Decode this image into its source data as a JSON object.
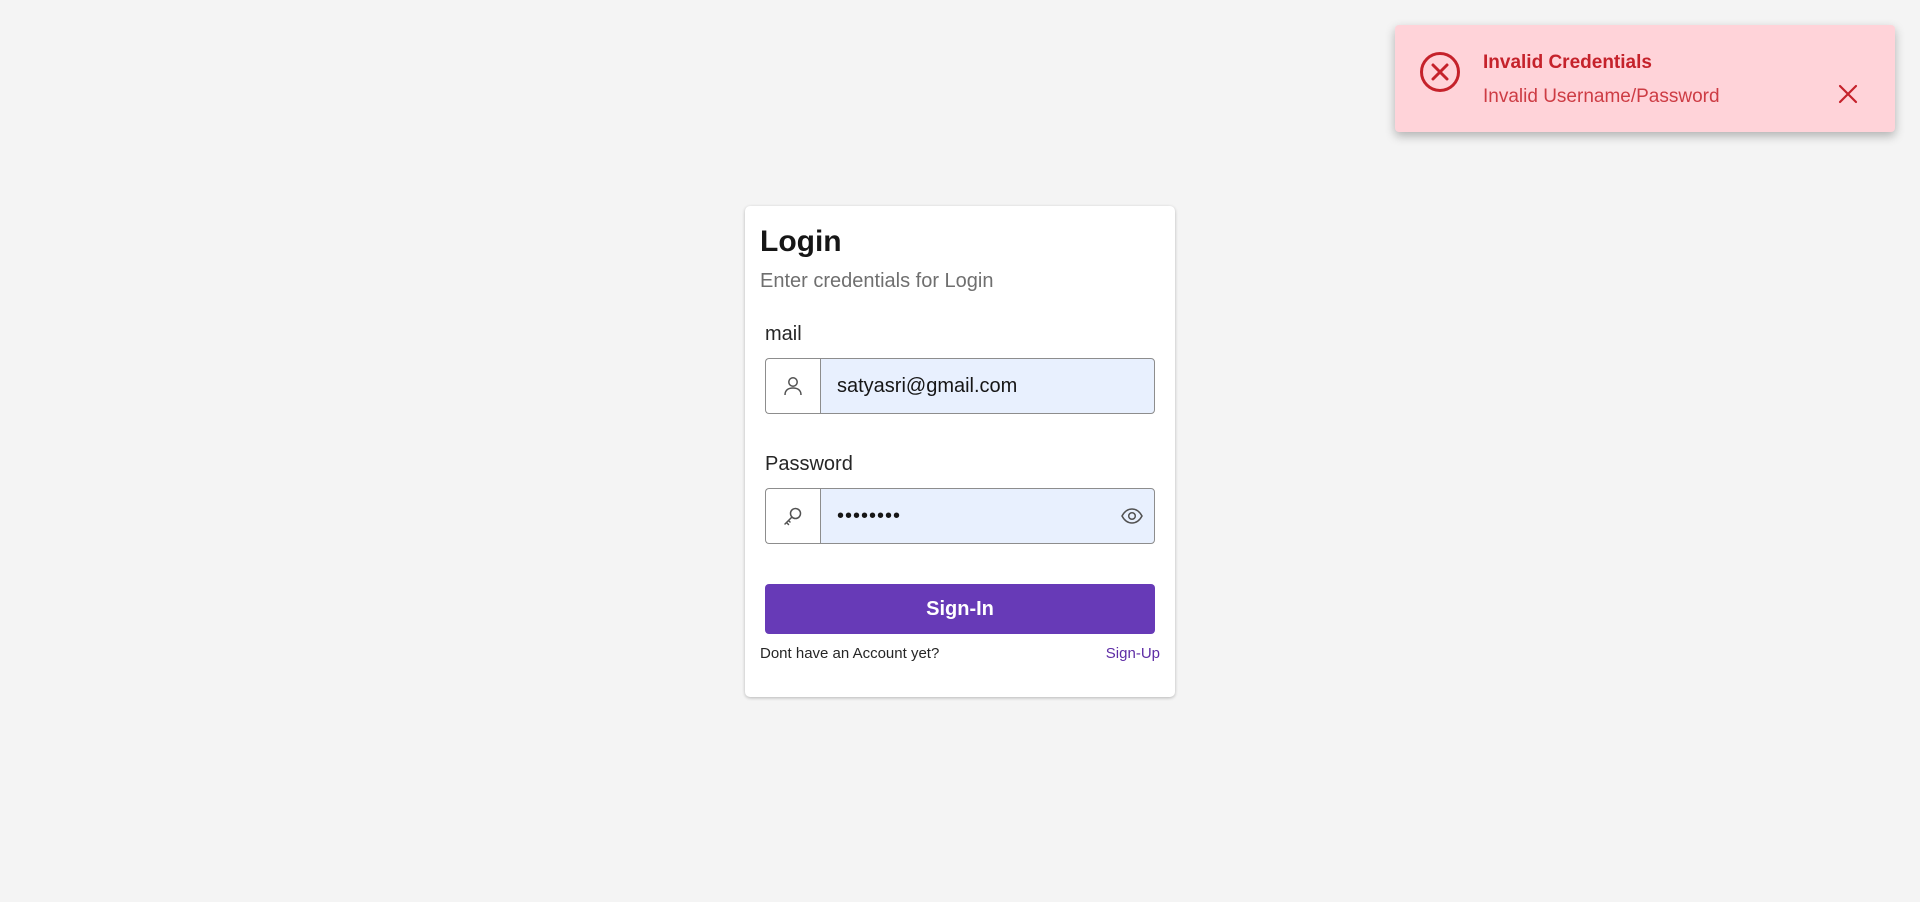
{
  "toast": {
    "title": "Invalid Credentials",
    "message": "Invalid Username/Password",
    "icon": "error-circle-x-icon",
    "close_icon": "close-icon",
    "background": "#ffd3d9",
    "color": "#c5222b"
  },
  "login": {
    "title": "Login",
    "subtitle": "Enter credentials for Login",
    "email": {
      "label": "mail",
      "value": "satyasri@gmail.com",
      "icon": "user-icon"
    },
    "password": {
      "label": "Password",
      "value": "password",
      "icon": "key-icon",
      "toggle_icon": "eye-icon"
    },
    "submit_label": "Sign-In",
    "footer_text": "Dont have an Account yet?",
    "signup_link": "Sign-Up",
    "accent": "#673ab7"
  }
}
